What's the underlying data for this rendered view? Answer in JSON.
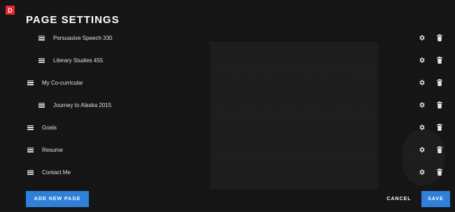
{
  "logo": {
    "letter": "D",
    "color": "#e8262b"
  },
  "header": {
    "title": "PAGE SETTINGS"
  },
  "pages": [
    {
      "label": "Persuasive Speech 330",
      "level": 1
    },
    {
      "label": "Literary Studies 455",
      "level": 1
    },
    {
      "label": "My Co-curricular",
      "level": 0
    },
    {
      "label": "Journey to Alaska 2015",
      "level": 1
    },
    {
      "label": "Goals",
      "level": 0
    },
    {
      "label": "Resume",
      "level": 0
    },
    {
      "label": "Contact Me",
      "level": 0
    }
  ],
  "row_icons": {
    "settings": "gear-icon",
    "delete": "trash-icon",
    "drag": "drag-handle-icon"
  },
  "footer": {
    "add_label": "ADD NEW PAGE",
    "cancel_label": "CANCEL",
    "save_label": "SAVE"
  },
  "colors": {
    "primary": "#2f80d9",
    "background": "#141414",
    "text": "#e6e6e6"
  }
}
